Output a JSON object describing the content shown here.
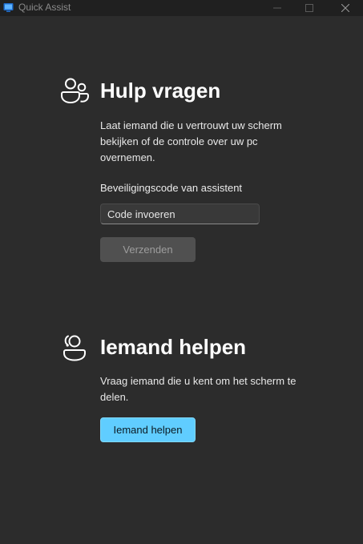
{
  "window": {
    "title": "Quick Assist",
    "accent": "#60cdff",
    "background": "#2c2c2c",
    "titlebar_background": "#202020"
  },
  "titlebar": {
    "app_icon": "quick-assist-icon",
    "controls": [
      "minimize-icon",
      "maximize-icon",
      "close-icon"
    ]
  },
  "get_help": {
    "icon": "people-icon",
    "heading": "Hulp vragen",
    "description": "Laat iemand die u vertrouwt uw scherm bekijken of de controle over uw pc overnemen.",
    "code_label": "Beveiligingscode van assistent",
    "code_placeholder": "Code invoeren",
    "code_value": "",
    "submit_label": "Verzenden"
  },
  "give_help": {
    "icon": "person-support-icon",
    "heading": "Iemand helpen",
    "description": "Vraag iemand die u kent om het scherm te delen.",
    "button_label": "Iemand helpen"
  }
}
